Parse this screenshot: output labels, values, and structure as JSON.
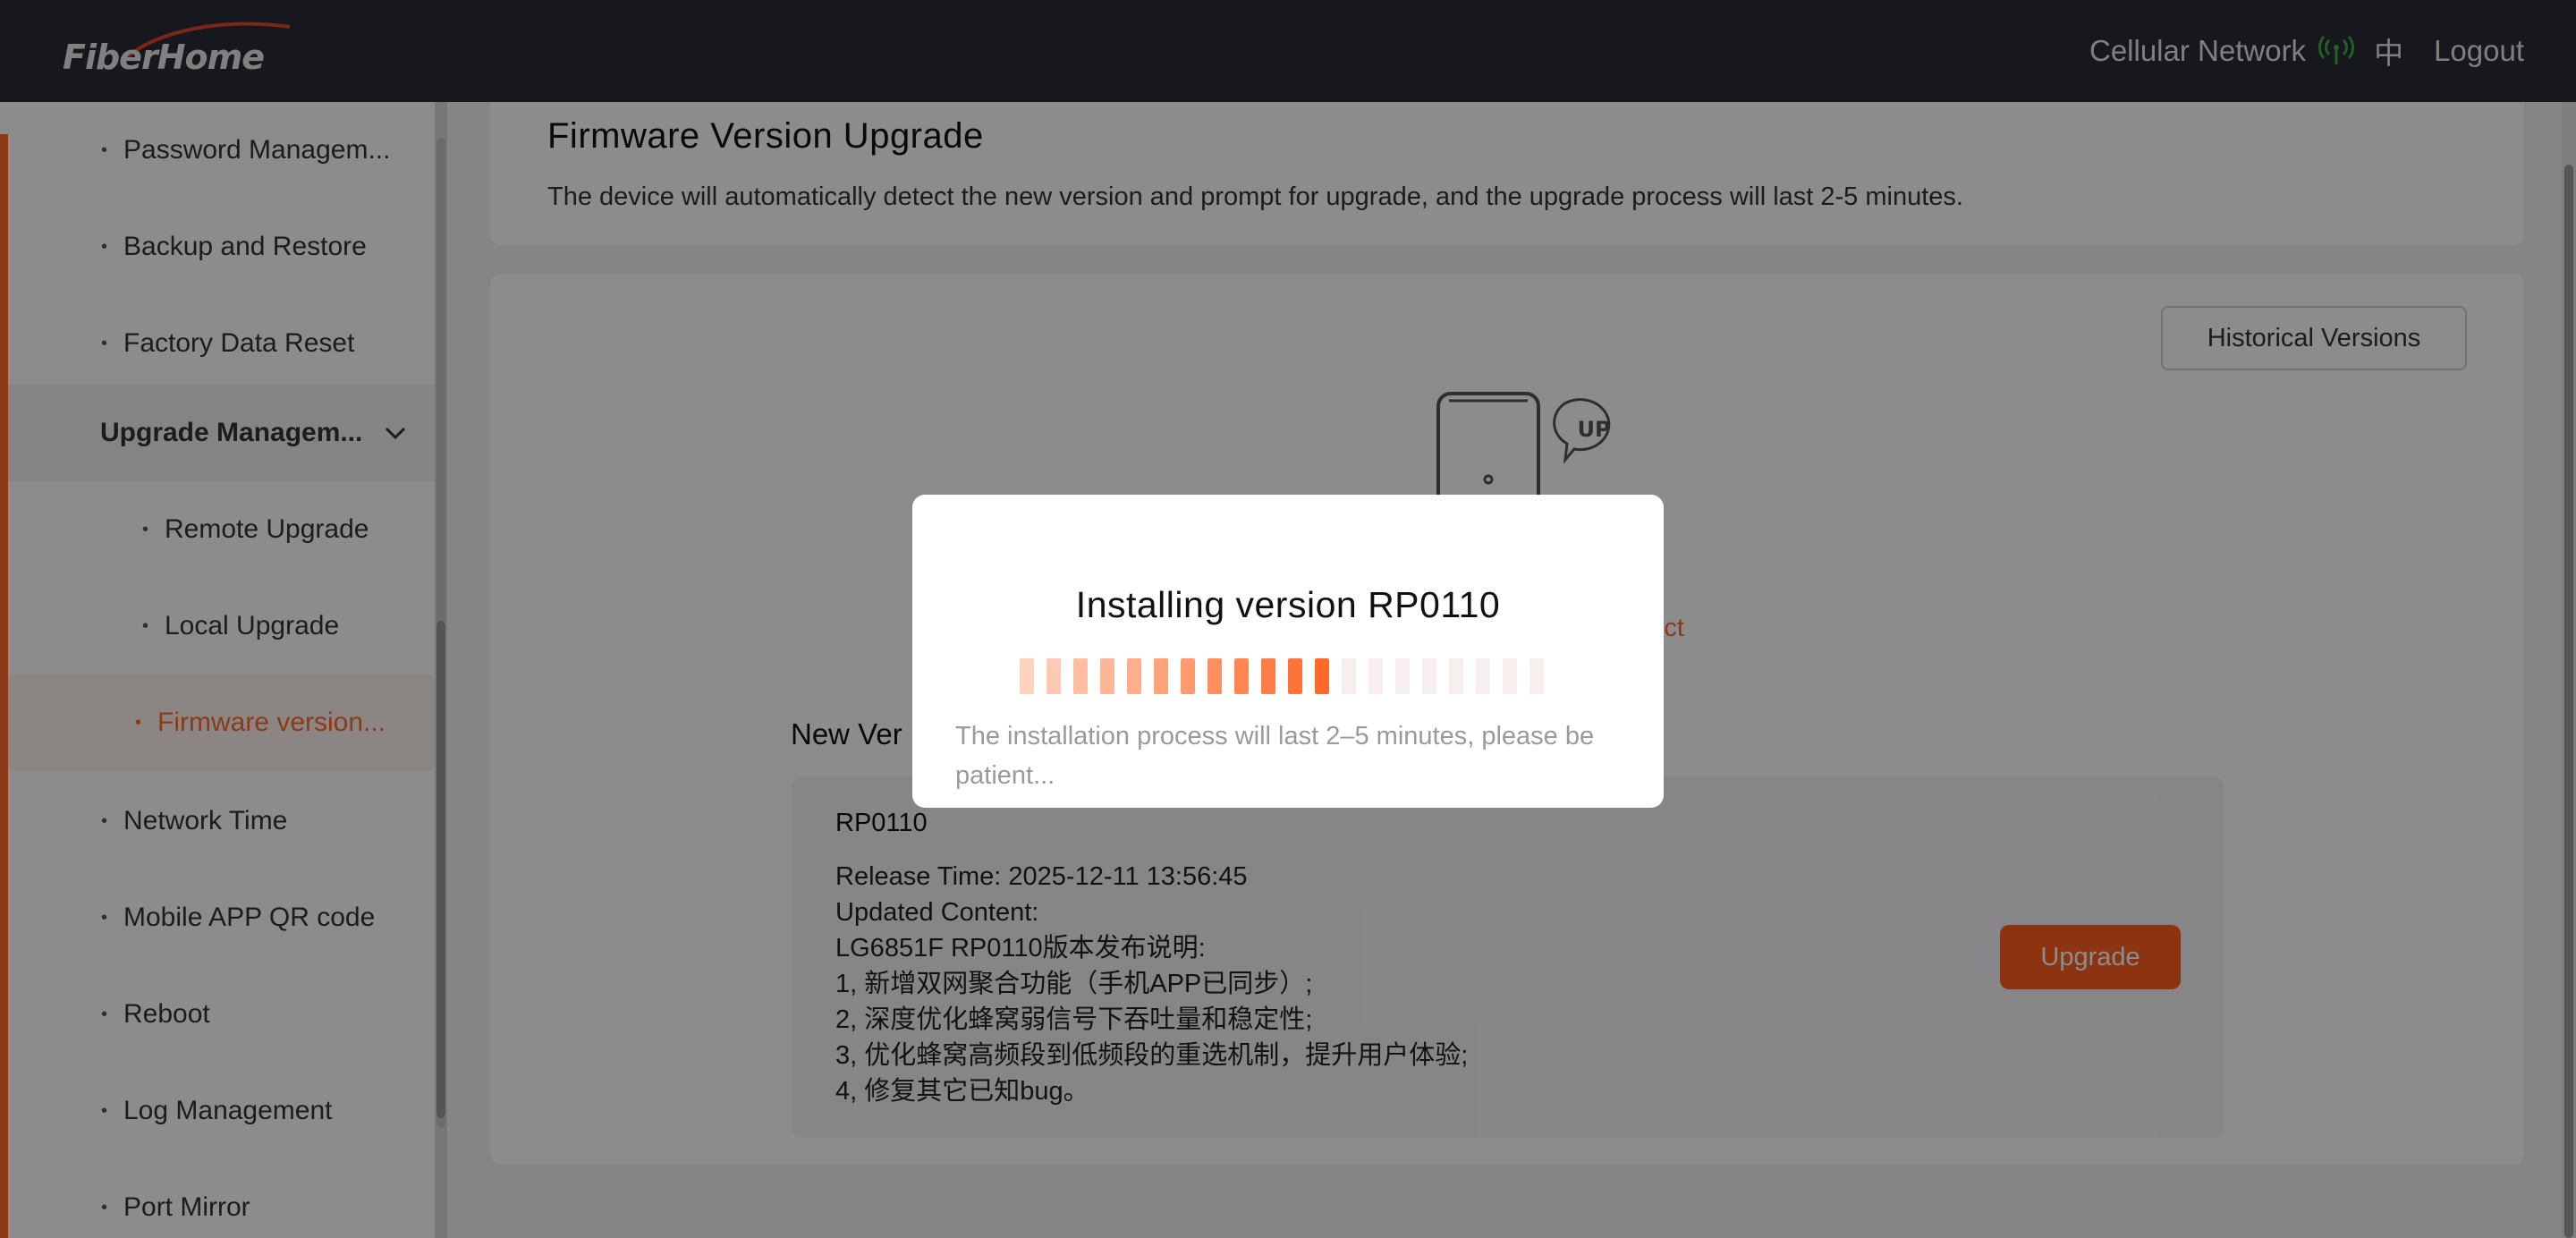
{
  "app": {
    "logo_text": "FiberHome"
  },
  "header": {
    "network_label": "Cellular Network",
    "network_icon": "signal-icon",
    "language": "中",
    "logout": "Logout"
  },
  "sidebar": {
    "items": [
      {
        "label": "Password Managem...",
        "level": 1
      },
      {
        "label": "Backup and Restore",
        "level": 1
      },
      {
        "label": "Factory Data Reset",
        "level": 1
      },
      {
        "label": "Upgrade Managem...",
        "level": 0,
        "expanded": true
      },
      {
        "label": "Remote Upgrade",
        "level": 2
      },
      {
        "label": "Local Upgrade",
        "level": 2
      },
      {
        "label": "Firmware version...",
        "level": 2,
        "active": true
      },
      {
        "label": "Network Time",
        "level": 1
      },
      {
        "label": "Mobile APP QR code",
        "level": 1
      },
      {
        "label": "Reboot",
        "level": 1
      },
      {
        "label": "Log Management",
        "level": 1
      },
      {
        "label": "Port Mirror",
        "level": 1
      }
    ]
  },
  "main": {
    "title": "Firmware Version Upgrade",
    "description": "The device will automatically detect the new version and prompt for upgrade, and the upgrade process will last 2-5 minutes.",
    "historical_button": "Historical Versions",
    "device_badge": "UP",
    "detect_link": "etect",
    "new_version_heading": "New Ver",
    "version": {
      "name": "RP0110",
      "release_time": "Release Time: 2025-12-11 13:56:45",
      "updated_content_label": "Updated Content:",
      "content_lines": [
        "LG6851F RP0110版本发布说明:",
        "1, 新增双网聚合功能（手机APP已同步）;",
        "2, 深度优化蜂窝弱信号下吞吐量和稳定性;",
        "3, 优化蜂窝高频段到低频段的重选机制，提升用户体验;",
        "4, 修复其它已知bug。"
      ]
    },
    "upgrade_button": "Upgrade"
  },
  "modal": {
    "title": "Installing version RP0110",
    "message": "The installation process will last 2–5 minutes, please be patient...",
    "progress_segments_total": 20,
    "progress_segments_filled": 12
  },
  "colors": {
    "accent": "#ff6a2b",
    "topbar": "#2a2d35",
    "signal": "#3fae49"
  }
}
